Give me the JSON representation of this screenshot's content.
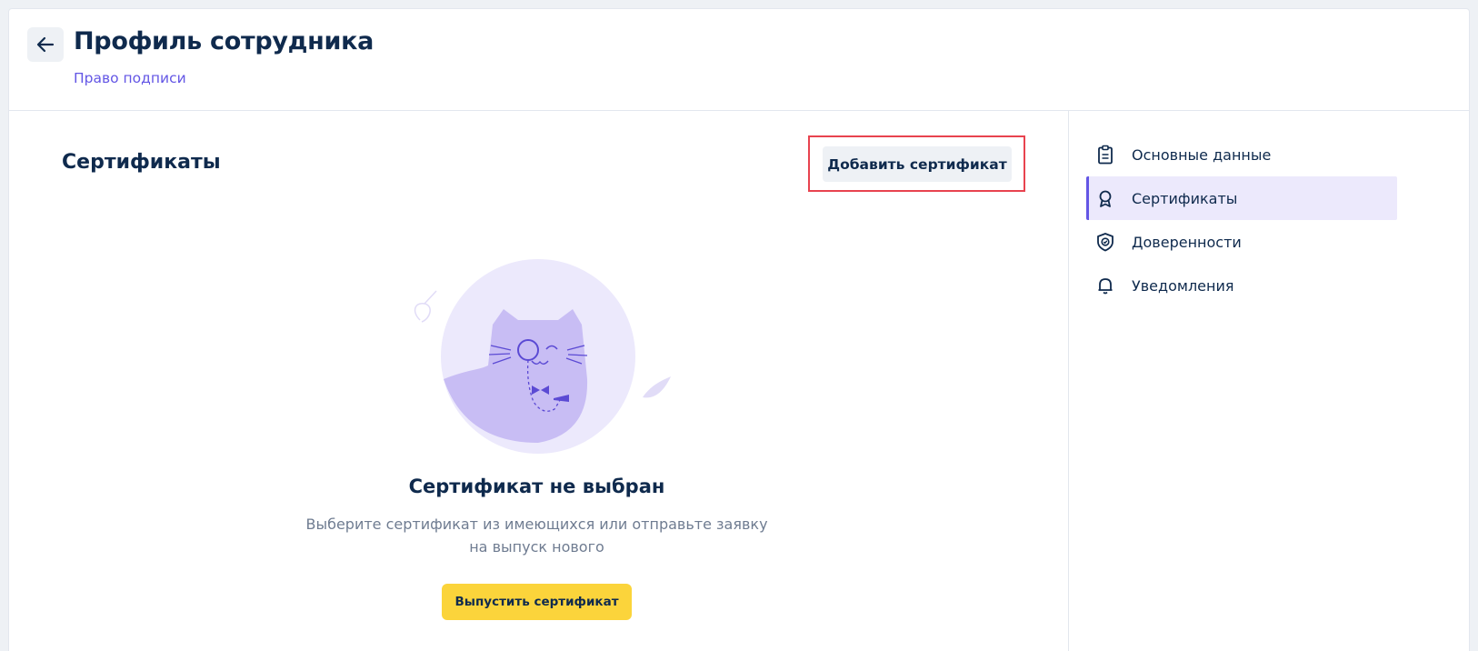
{
  "header": {
    "title": "Профиль сотрудника",
    "subtitle": "Право подписи"
  },
  "main": {
    "section_title": "Сертификаты",
    "add_button_label": "Добавить сертификат",
    "empty_state": {
      "title": "Сертификат не выбран",
      "text_line1": "Выберите сертификат из имеющихся или отправьте заявку",
      "text_line2": "на выпуск нового",
      "button_label": "Выпустить сертификат"
    }
  },
  "sidebar": {
    "items": [
      {
        "label": "Основные данные",
        "icon": "clipboard-icon",
        "active": false
      },
      {
        "label": "Сертификаты",
        "icon": "award-icon",
        "active": true
      },
      {
        "label": "Доверенности",
        "icon": "shield-icon",
        "active": false
      },
      {
        "label": "Уведомления",
        "icon": "bell-icon",
        "active": false
      }
    ]
  },
  "colors": {
    "accent": "#6356e5",
    "primary_button": "#fbd43b",
    "text_primary": "#0f2a4d",
    "text_secondary": "#6f7c91",
    "highlight": "#e8434f"
  }
}
